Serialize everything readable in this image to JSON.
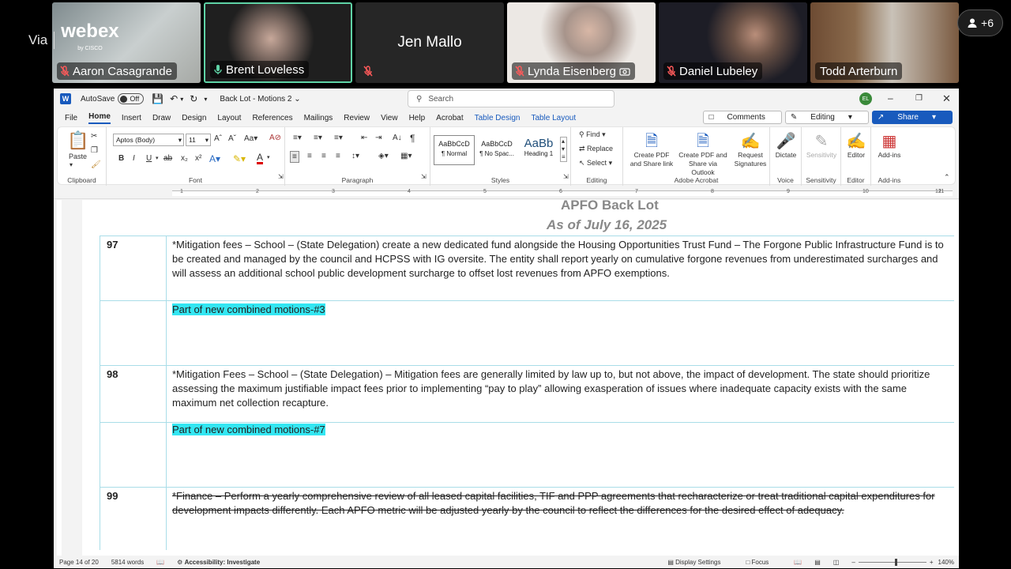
{
  "meeting": {
    "brand_via": "Via",
    "brand_name": "webex",
    "brand_sub": "by CISCO",
    "overflow_count": "+6",
    "participants": [
      {
        "name": "Aaron Casagrande",
        "muted": true
      },
      {
        "name": "Brent Loveless",
        "muted": false,
        "active": true
      },
      {
        "name": "Jen Mallo",
        "muted": true
      },
      {
        "name": "Lynda Eisenberg",
        "muted": true
      },
      {
        "name": "Daniel Lubeley",
        "muted": true
      },
      {
        "name": "Todd Arterburn",
        "muted": false
      }
    ]
  },
  "word": {
    "autosave_label": "AutoSave",
    "autosave_state": "Off",
    "doc_title": "Back Lot - Motions 2",
    "search_placeholder": "Search",
    "user_initials": "EL",
    "menu": [
      "File",
      "Home",
      "Insert",
      "Draw",
      "Design",
      "Layout",
      "References",
      "Mailings",
      "Review",
      "View",
      "Help",
      "Acrobat",
      "Table Design",
      "Table Layout"
    ],
    "menu_selected": "Home",
    "buttons": {
      "comments": "Comments",
      "editing": "Editing",
      "share": "Share"
    },
    "ribbon": {
      "paste": "Paste",
      "font_name": "Aptos (Body)",
      "font_size": "11",
      "style_normal_sample": "AaBbCcD",
      "style_normal": "¶ Normal",
      "style_nospace_sample": "AaBbCcD",
      "style_nospace": "¶ No Spac...",
      "style_h1_sample": "AaBb",
      "style_h1": "Heading 1",
      "find": "Find",
      "replace": "Replace",
      "select": "Select",
      "create_pdf_share": "Create PDF and Share link",
      "create_pdf_outlook": "Create PDF and Share via Outlook",
      "request_sig": "Request Signatures",
      "dictate": "Dictate",
      "sensitivity": "Sensitivity",
      "editor": "Editor",
      "addins": "Add-ins",
      "groups": {
        "clipboard": "Clipboard",
        "font": "Font",
        "paragraph": "Paragraph",
        "styles": "Styles",
        "editing": "Editing",
        "acrobat": "Adobe Acrobat",
        "voice": "Voice",
        "sensitivity": "Sensitivity",
        "editor": "Editor",
        "addins": "Add-ins"
      }
    },
    "ruler_ticks": [
      "1",
      "2",
      "3",
      "4",
      "5",
      "6",
      "7",
      "8",
      "9",
      "10",
      "11",
      "12"
    ],
    "document": {
      "heading": "APFO Back Lot",
      "subheading": "As of July 16, 2025",
      "rows": [
        {
          "num": "97",
          "text": "*Mitigation fees – School – (State Delegation) create a new dedicated fund alongside the Housing Opportunities Trust Fund – The Forgone Public Infrastructure Fund is to be created and managed by the council and HCPSS with IG oversite. The entity shall report yearly on cumulative forgone revenues from underestimated surcharges and will assess an additional school public development surcharge to offset lost revenues from APFO exemptions.",
          "strike": false
        },
        {
          "num": "",
          "text": "Part of new combined motions-#3",
          "highlight": true
        },
        {
          "num": "98",
          "text": "*Mitigation Fees – School – (State Delegation) – Mitigation fees are generally limited by law up to, but not above, the impact of development. The state should prioritize assessing the maximum justifiable impact fees prior to implementing “pay to play” allowing exasperation of issues where inadequate capacity exists with the same maximum net collection recapture.",
          "strike": false
        },
        {
          "num": "",
          "text": "Part of new combined motions-#7",
          "highlight": true
        },
        {
          "num": "99",
          "text": "*Finance – Perform a yearly comprehensive review of all leased capital facilities, TIF and PPP agreements that recharacterize or treat traditional capital expenditures for development impacts differently. Each APFO metric will be adjusted yearly by the council to reflect the differences for the desired effect of adequacy.",
          "strike": true
        }
      ]
    },
    "status": {
      "page": "Page 14 of 20",
      "words": "5814 words",
      "accessibility": "Accessibility: Investigate",
      "display_settings": "Display Settings",
      "focus": "Focus",
      "zoom": "140%"
    }
  }
}
